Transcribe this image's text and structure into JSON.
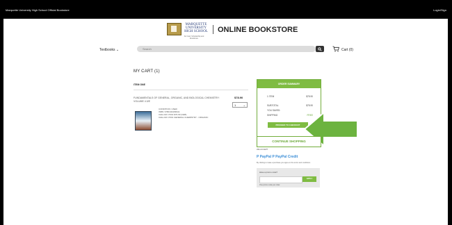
{
  "topbar": {
    "left_text": "Marquette University High School Official Bookstore",
    "right_text": "Login/Sign"
  },
  "brand": {
    "school_name": "MARQUETTE UNIVERSITY HIGH SCHOOL",
    "tagline": "For God, Scholarship and Excellence",
    "store_name": "ONLINE BOOKSTORE"
  },
  "nav": {
    "textbooks": "Textbooks",
    "search_placeholder": "Search",
    "cart": "Cart (0)"
  },
  "cart": {
    "heading": "MY CART (1)",
    "item_label": "ITEM ONE",
    "item_title": "FUNDAMENTALS OF GENERAL, ORGANIC, AND BIOLOGICAL CHEMISTRY: VOLUME 4.3/E",
    "item_price": "$78.90",
    "qty": "1",
    "detail_1": "CONDITION: USED",
    "detail_2": "ISBN: 9780134409941",
    "detail_3": "CHE 222 17001   $79.99 (CEB)",
    "detail_4": "CHE 222 17001 GENERAL CHEMISTRY - ORGANIC"
  },
  "summary": {
    "heading": "ORDER SUMMARY",
    "items_label": "1 ITEM",
    "items_value": "$78.90",
    "subtotal_label": "SUBTOTAL",
    "subtotal_value": "$78.90",
    "saved_label": "YOU SAVED:",
    "shipping_label": "SHIPPING",
    "shipping_value": "FREE",
    "checkout": "PROCEED TO CHECKOUT"
  },
  "continue_button": "CONTINUE SHOPPING",
  "payment": {
    "accepted": "WE ACCEPT",
    "paypal": "PayPal",
    "paypal_credit": "PayPal Credit",
    "small_text": "By clicking to make a purchase you agree to the terms and conditions."
  },
  "promo": {
    "question": "Have a promo code?",
    "apply": "APPLY",
    "note": "One promo code per order."
  },
  "colors": {
    "accent": "#7fbc42",
    "dark": "#000000"
  }
}
